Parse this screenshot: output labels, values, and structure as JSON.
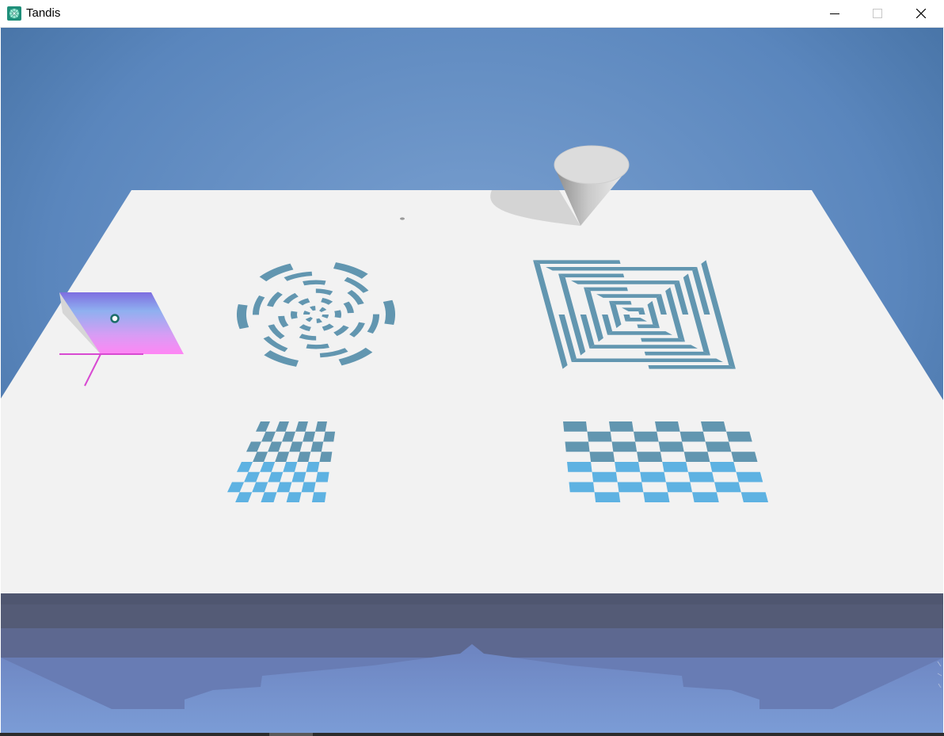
{
  "window": {
    "title": "Tandis",
    "icon": "tandis-app-icon",
    "controls": {
      "minimize": "minimize-icon",
      "maximize": "maximize-icon",
      "close": "close-icon"
    }
  },
  "scene": {
    "colors": {
      "sky_top": "#3a6695",
      "sky_bottom": "#6a92c4",
      "table": "#f2f2f2",
      "pattern": "#6296b0",
      "pattern_light": "#5eb2e2",
      "cone": "#c8c8c8",
      "plane_top": "#8a7ce0",
      "plane_bottom": "#ff8cf6",
      "axis": "#e040d8"
    },
    "objects": [
      "cone",
      "gradient-plane",
      "radial-target-pattern",
      "square-spiral-pattern",
      "checkerboard-small",
      "checkerboard-large"
    ]
  }
}
